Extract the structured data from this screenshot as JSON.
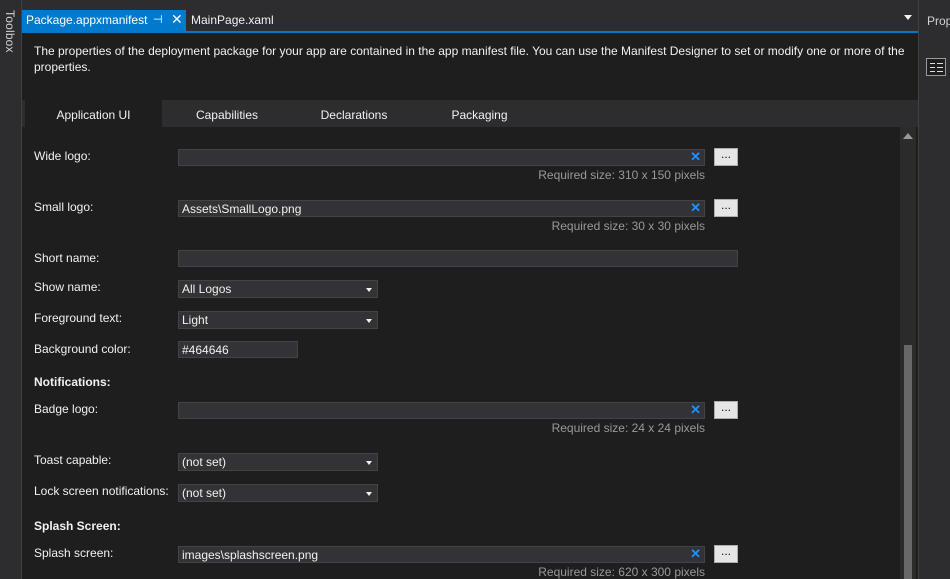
{
  "toolbox": {
    "label": "Toolbox"
  },
  "tabs": {
    "active": {
      "label": "Package.appxmanifest",
      "pin": "⊣",
      "close": "✕"
    },
    "inactive": {
      "label": "MainPage.xaml"
    }
  },
  "properties_panel": {
    "label": "Prop"
  },
  "description": "The properties of the deployment package for your app are contained in the app manifest file. You can use the Manifest Designer to set or modify one or more of the properties.",
  "designer_tabs": [
    {
      "label": "Application UI"
    },
    {
      "label": "Capabilities"
    },
    {
      "label": "Declarations"
    },
    {
      "label": "Packaging"
    }
  ],
  "form": {
    "wide_logo": {
      "label": "Wide logo:",
      "value": "",
      "required": "Required size: 310 x 150 pixels"
    },
    "small_logo": {
      "label": "Small logo:",
      "value": "Assets\\SmallLogo.png",
      "required": "Required size: 30 x 30 pixels"
    },
    "short_name": {
      "label": "Short name:",
      "value": ""
    },
    "show_name": {
      "label": "Show name:",
      "value": "All Logos"
    },
    "foreground_text": {
      "label": "Foreground text:",
      "value": "Light"
    },
    "background_color": {
      "label": "Background color:",
      "value": "#464646"
    },
    "notifications_heading": "Notifications:",
    "badge_logo": {
      "label": "Badge logo:",
      "value": "",
      "required": "Required size: 24 x 24 pixels"
    },
    "toast_capable": {
      "label": "Toast capable:",
      "value": "(not set)"
    },
    "lock_screen": {
      "label": "Lock screen notifications:",
      "value": "(not set)"
    },
    "splash_heading": "Splash Screen:",
    "splash_screen": {
      "label": "Splash screen:",
      "value": "images\\splashscreen.png",
      "required": "Required size: 620 x 300 pixels"
    },
    "browse_label": "...",
    "clear_label": "✕"
  },
  "colors": {
    "accent": "#007acc",
    "editor_bg": "#1e1e1e",
    "chrome_bg": "#2d2d30",
    "clear_icon": "#1e90ff"
  }
}
